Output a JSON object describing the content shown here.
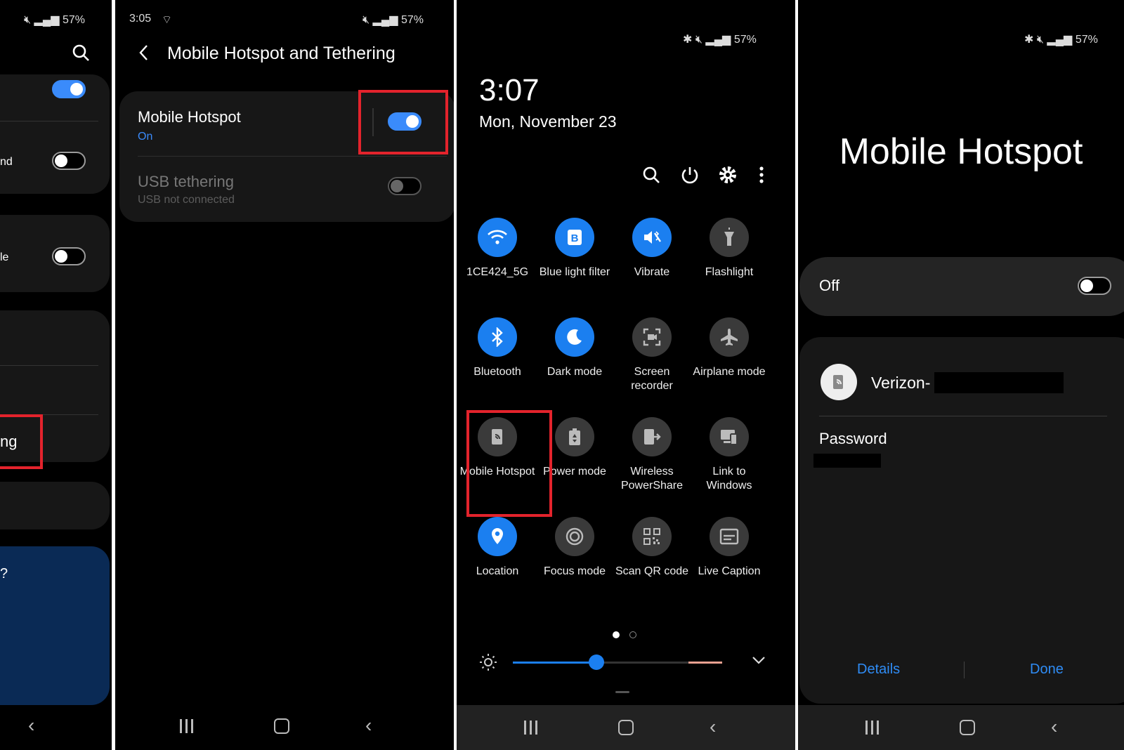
{
  "panel1": {
    "status_battery": "57%",
    "row_partial_1": "nd",
    "row_partial_2": "le",
    "highlight_partial": "ng",
    "card_partial": "?"
  },
  "panel2": {
    "status_time": "3:05",
    "status_battery": "57%",
    "title": "Mobile Hotspot and Tethering",
    "items": [
      {
        "label": "Mobile Hotspot",
        "sublabel": "On",
        "toggle": "on"
      },
      {
        "label": "USB tethering",
        "sublabel": "USB not connected",
        "toggle": "off-disabled"
      }
    ]
  },
  "panel3": {
    "status_battery": "57%",
    "time": "3:07",
    "date": "Mon, November 23",
    "tiles": [
      {
        "label": "1CE424_5G",
        "icon": "wifi-icon",
        "active": true
      },
      {
        "label": "Blue light filter",
        "icon": "blue-light-icon",
        "active": true
      },
      {
        "label": "Vibrate",
        "icon": "vibrate-icon",
        "active": true
      },
      {
        "label": "Flashlight",
        "icon": "flashlight-icon",
        "active": false
      },
      {
        "label": "Bluetooth",
        "icon": "bluetooth-icon",
        "active": true
      },
      {
        "label": "Dark mode",
        "icon": "moon-icon",
        "active": true
      },
      {
        "label": "Screen recorder",
        "icon": "screen-recorder-icon",
        "active": false
      },
      {
        "label": "Airplane mode",
        "icon": "airplane-icon",
        "active": false
      },
      {
        "label": "Mobile Hotspot",
        "icon": "hotspot-icon",
        "active": false
      },
      {
        "label": "Power mode",
        "icon": "power-mode-icon",
        "active": false
      },
      {
        "label": "Wireless PowerShare",
        "icon": "powershare-icon",
        "active": false
      },
      {
        "label": "Link to Windows",
        "icon": "link-windows-icon",
        "active": false
      },
      {
        "label": "Location",
        "icon": "location-icon",
        "active": true
      },
      {
        "label": "Focus mode",
        "icon": "focus-icon",
        "active": false
      },
      {
        "label": "Scan QR code",
        "icon": "qr-icon",
        "active": false
      },
      {
        "label": "Live Caption",
        "icon": "caption-icon",
        "active": false
      }
    ],
    "brightness": 0.4,
    "page_count": 2,
    "active_page": 1
  },
  "panel4": {
    "status_battery": "57%",
    "title": "Mobile Hotspot",
    "state_label": "Off",
    "network_name": "Verizon-",
    "password_label": "Password",
    "details_label": "Details",
    "done_label": "Done"
  },
  "colors": {
    "accent": "#1b7ff0",
    "highlight": "#e3232c",
    "background": "#000000"
  }
}
